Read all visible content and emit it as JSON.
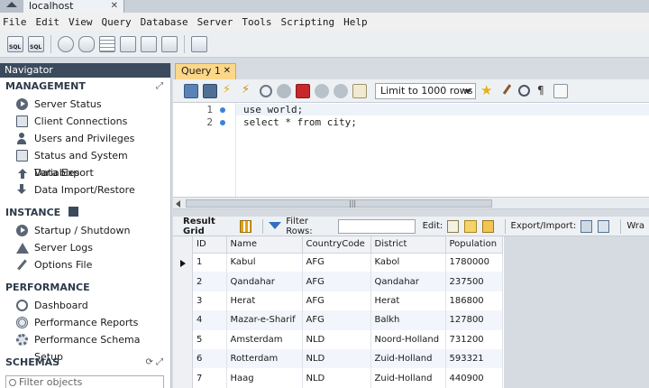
{
  "window": {
    "connection_tab": "localhost"
  },
  "menu": [
    "File",
    "Edit",
    "View",
    "Query",
    "Database",
    "Server",
    "Tools",
    "Scripting",
    "Help"
  ],
  "main_toolbar": {
    "buttons": [
      "new-sql-tab",
      "open-sql-script",
      "inspector",
      "create-schema",
      "create-table",
      "create-view",
      "create-procedure",
      "create-function",
      "search-table-data",
      "reconnect"
    ]
  },
  "navigator": {
    "header": "Navigator",
    "management": {
      "title": "MANAGEMENT",
      "items": [
        "Server Status",
        "Client Connections",
        "Users and Privileges",
        "Status and System Variables",
        "Data Export",
        "Data Import/Restore"
      ]
    },
    "instance": {
      "title": "INSTANCE",
      "items": [
        "Startup / Shutdown",
        "Server Logs",
        "Options File"
      ]
    },
    "performance": {
      "title": "PERFORMANCE",
      "items": [
        "Dashboard",
        "Performance Reports",
        "Performance Schema Setup"
      ]
    },
    "schemas": {
      "title": "SCHEMAS",
      "filter_placeholder": "Filter objects"
    }
  },
  "editor": {
    "tab_label": "Query 1",
    "limit_label": "Limit to 1000 rows",
    "lines": [
      {
        "num": "1",
        "text": "use world;"
      },
      {
        "num": "2",
        "text": "select * from city;"
      }
    ]
  },
  "result_toolbar": {
    "result_grid": "Result Grid",
    "filter_rows": "Filter Rows:",
    "edit": "Edit:",
    "export_import": "Export/Import:",
    "wrap": "Wra"
  },
  "result": {
    "columns": [
      "ID",
      "Name",
      "CountryCode",
      "District",
      "Population"
    ],
    "rows": [
      [
        "1",
        "Kabul",
        "AFG",
        "Kabol",
        "1780000"
      ],
      [
        "2",
        "Qandahar",
        "AFG",
        "Qandahar",
        "237500"
      ],
      [
        "3",
        "Herat",
        "AFG",
        "Herat",
        "186800"
      ],
      [
        "4",
        "Mazar-e-Sharif",
        "AFG",
        "Balkh",
        "127800"
      ],
      [
        "5",
        "Amsterdam",
        "NLD",
        "Noord-Holland",
        "731200"
      ],
      [
        "6",
        "Rotterdam",
        "NLD",
        "Zuid-Holland",
        "593321"
      ],
      [
        "7",
        "Haag",
        "NLD",
        "Zuid-Holland",
        "440900"
      ]
    ]
  }
}
